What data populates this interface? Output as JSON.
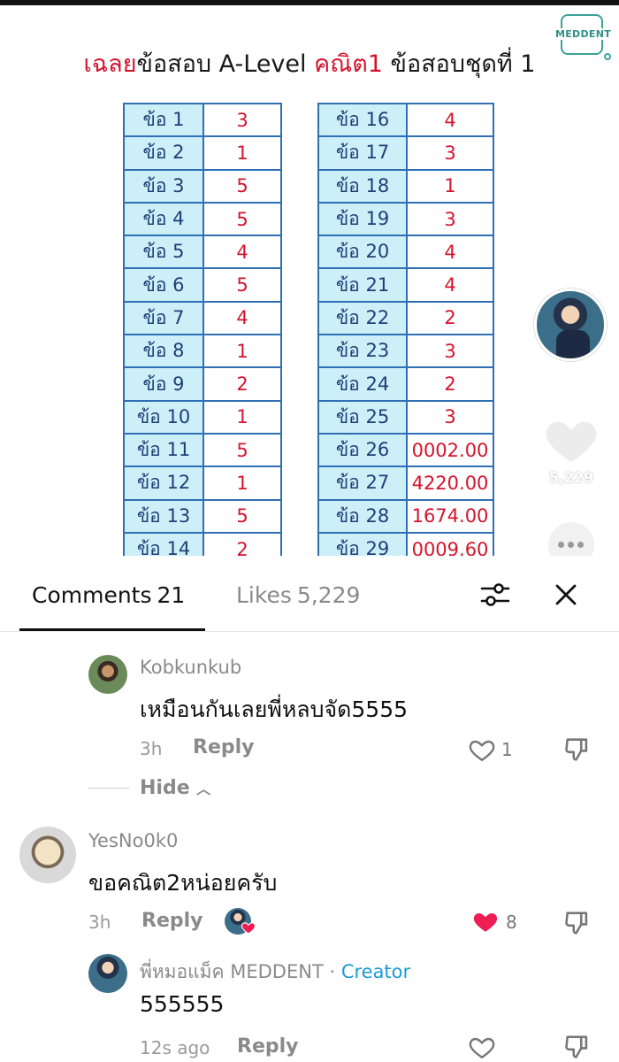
{
  "video": {
    "title_part1": "เฉลย",
    "title_part2": "ข้อสอบ A-Level ",
    "title_part3": "คณิต1",
    "title_part4": " ข้อสอบชุดที่ 1",
    "logo_text": "MEDDENT",
    "answers_left": [
      {
        "q": "ข้อ 1",
        "a": "3"
      },
      {
        "q": "ข้อ 2",
        "a": "1"
      },
      {
        "q": "ข้อ 3",
        "a": "5"
      },
      {
        "q": "ข้อ 4",
        "a": "5"
      },
      {
        "q": "ข้อ 5",
        "a": "4"
      },
      {
        "q": "ข้อ 6",
        "a": "5"
      },
      {
        "q": "ข้อ 7",
        "a": "4"
      },
      {
        "q": "ข้อ 8",
        "a": "1"
      },
      {
        "q": "ข้อ 9",
        "a": "2"
      },
      {
        "q": "ข้อ 10",
        "a": "1"
      },
      {
        "q": "ข้อ 11",
        "a": "5"
      },
      {
        "q": "ข้อ 12",
        "a": "1"
      },
      {
        "q": "ข้อ 13",
        "a": "5"
      },
      {
        "q": "ข้อ 14",
        "a": "2"
      }
    ],
    "answers_right": [
      {
        "q": "ข้อ 16",
        "a": "4"
      },
      {
        "q": "ข้อ 17",
        "a": "3"
      },
      {
        "q": "ข้อ 18",
        "a": "1"
      },
      {
        "q": "ข้อ 19",
        "a": "3"
      },
      {
        "q": "ข้อ 20",
        "a": "4"
      },
      {
        "q": "ข้อ 21",
        "a": "4"
      },
      {
        "q": "ข้อ 22",
        "a": "2"
      },
      {
        "q": "ข้อ 23",
        "a": "3"
      },
      {
        "q": "ข้อ 24",
        "a": "2"
      },
      {
        "q": "ข้อ 25",
        "a": "3"
      },
      {
        "q": "ข้อ 26",
        "a": "0002.00"
      },
      {
        "q": "ข้อ 27",
        "a": "4220.00"
      },
      {
        "q": "ข้อ 28",
        "a": "1674.00"
      },
      {
        "q": "ข้อ 29",
        "a": "0009.60"
      }
    ],
    "like_count": "5,229"
  },
  "panel": {
    "comments_label": "Comments",
    "comments_count": "21",
    "likes_label": "Likes",
    "likes_count": "5,229"
  },
  "comments": [
    {
      "user": "Kobkunkub",
      "text": "เหมือนกันเลยพี่หลบจัด5555",
      "time": "3h",
      "reply": "Reply",
      "likes": "1"
    },
    {
      "hide_label": "Hide"
    },
    {
      "user": "YesNo0k0",
      "text": "ขอคณิต2หน่อยครับ",
      "time": "3h",
      "reply": "Reply",
      "likes": "8"
    },
    {
      "user": "พี่หมอแม็ค MEDDENT",
      "separator": " · ",
      "creator": "Creator",
      "text": "555555",
      "time": "12s ago",
      "reply": "Reply"
    }
  ],
  "colors": {
    "accent_red": "#d4142c",
    "creator_blue": "#1c9ad6",
    "table_border": "#2f6fb5",
    "table_q_bg": "#cdeff7",
    "liked_heart": "#ee1d52"
  }
}
